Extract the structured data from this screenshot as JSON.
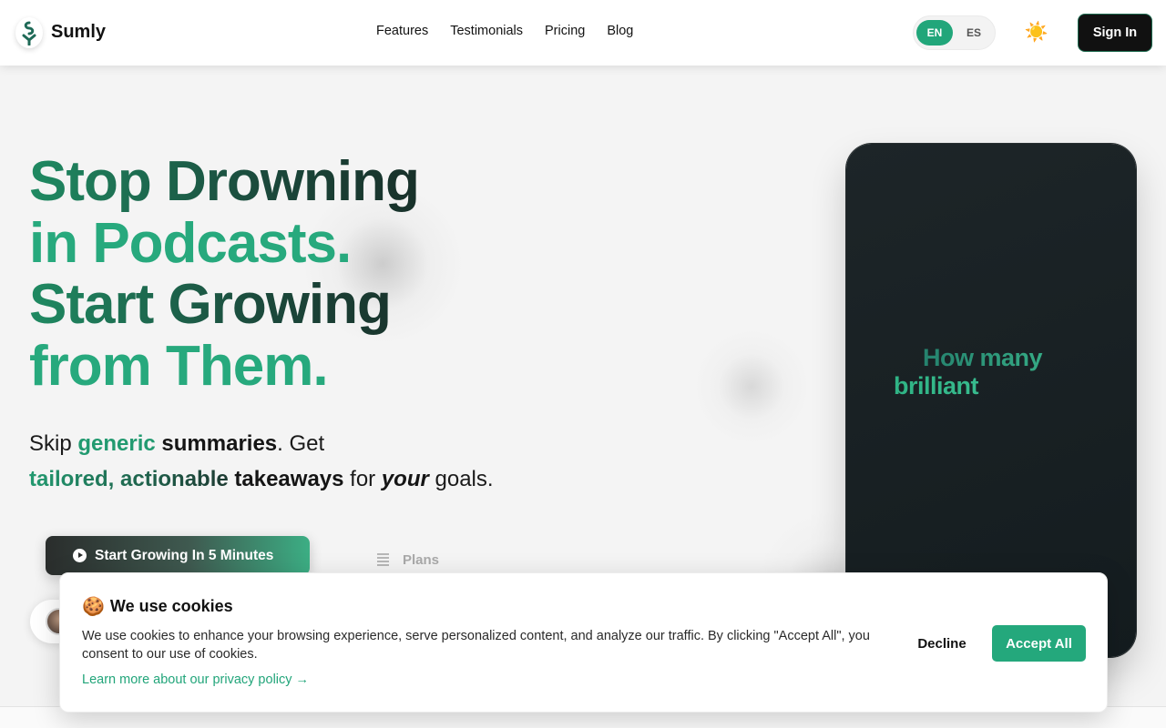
{
  "header": {
    "brand": "Sumly",
    "nav": [
      "Features",
      "Testimonials",
      "Pricing",
      "Blog"
    ],
    "lang_en": "EN",
    "lang_es": "ES",
    "active_lang": "EN",
    "theme_icon": "☀️",
    "signin_label": "Sign In"
  },
  "hero": {
    "title_line1": "Stop Drowning",
    "title_line2": "in Podcasts.",
    "title_line3": "Start Growing",
    "title_line4": "from Them.",
    "sub_skip": "Skip ",
    "sub_generic": "generic",
    "sub_summaries": "summaries",
    "sub_get": ". Get",
    "sub_tailored": "tailored, actionable",
    "sub_takeaways": "takeaways",
    "sub_for": " for ",
    "sub_your": "your",
    "sub_goals": " goals.",
    "cta_label": "Start Growing In 5 Minutes",
    "plans_label": "Plans"
  },
  "phone": {
    "line1": "How many",
    "line2": "brilliant"
  },
  "cookie": {
    "icon": "🍪",
    "title": "We use cookies",
    "body": "We use cookies to enhance your browsing experience, serve personalized content, and analyze our traffic. By clicking \"Accept All\", you consent to our use of cookies.",
    "link": "Learn more about our privacy policy →",
    "decline": "Decline",
    "accept": "Accept All"
  },
  "colors": {
    "accent": "#24a87c",
    "dark": "#111111",
    "phone_bg": "#182022"
  }
}
